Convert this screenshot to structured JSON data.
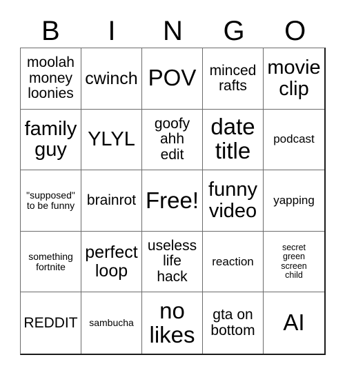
{
  "card": {
    "title": "BINGO",
    "headers": [
      "B",
      "I",
      "N",
      "G",
      "O"
    ],
    "free_space_label": "Free!",
    "colors": {
      "background": "#ffffff",
      "text": "#000000",
      "grid_line": "#6b6b6b",
      "grid_border": "#1a1a1a"
    },
    "rows": [
      [
        {
          "text": "moolah\nmoney\nloonies",
          "size": "fs-md"
        },
        {
          "text": "cwinch",
          "size": "fs-lg"
        },
        {
          "text": "POV",
          "size": "fs-xxl"
        },
        {
          "text": "minced\nrafts",
          "size": "fs-md"
        },
        {
          "text": "movie\nclip",
          "size": "fs-xl"
        }
      ],
      [
        {
          "text": "family\nguy",
          "size": "fs-xl"
        },
        {
          "text": "YLYL",
          "size": "fs-xl"
        },
        {
          "text": "goofy\nahh\nedit",
          "size": "fs-md"
        },
        {
          "text": "date\ntitle",
          "size": "fs-xxl"
        },
        {
          "text": "podcast",
          "size": "fs-sm"
        }
      ],
      [
        {
          "text": "\"supposed\"\nto be funny",
          "size": "fs-xs"
        },
        {
          "text": "brainrot",
          "size": "fs-md"
        },
        {
          "text": "Free!",
          "size": "fs-xxl"
        },
        {
          "text": "funny\nvideo",
          "size": "fs-xl"
        },
        {
          "text": "yapping",
          "size": "fs-sm"
        }
      ],
      [
        {
          "text": "something\nfortnite",
          "size": "fs-xs"
        },
        {
          "text": "perfect\nloop",
          "size": "fs-lg"
        },
        {
          "text": "useless\nlife\nhack",
          "size": "fs-md"
        },
        {
          "text": "reaction",
          "size": "fs-sm"
        },
        {
          "text": "secret\ngreen\nscreen\nchild",
          "size": "fs-xxs"
        }
      ],
      [
        {
          "text": "REDDIT",
          "size": "fs-md"
        },
        {
          "text": "sambucha",
          "size": "fs-xs"
        },
        {
          "text": "no\nlikes",
          "size": "fs-xxl"
        },
        {
          "text": "gta on\nbottom",
          "size": "fs-md"
        },
        {
          "text": "AI",
          "size": "fs-xxl"
        }
      ]
    ]
  }
}
